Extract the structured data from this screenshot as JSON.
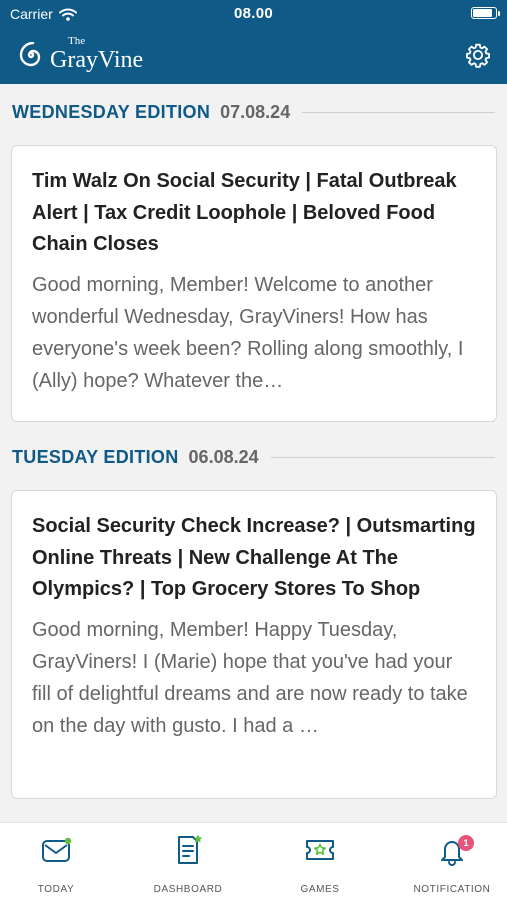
{
  "status_bar": {
    "carrier": "Carrier",
    "time": "08.00"
  },
  "header": {
    "brand_small": "The",
    "brand": "GrayVine"
  },
  "sections": [
    {
      "edition": "WEDNESDAY EDITION",
      "date": "07.08.24",
      "title": "Tim Walz On Social Security | Fatal Outbreak Alert | Tax Credit Loophole | Beloved Food Chain Closes",
      "excerpt": "Good morning, Member! Welcome to another wonderful Wednesday, GrayViners! How has everyone's week been? Rolling along smoothly, I (Ally) hope? Whatever the…"
    },
    {
      "edition": "TUESDAY EDITION",
      "date": "06.08.24",
      "title": "Social Security Check Increase? | Outsmarting Online Threats | New Challenge At The Olympics? | Top Grocery Stores To Shop",
      "excerpt": "Good morning, Member! Happy Tuesday, GrayViners! I (Marie) hope that you've had your fill of delightful dreams and are now ready to take on the day with gusto. I had a …"
    }
  ],
  "nav": {
    "today": "TODAY",
    "dashboard": "DASHBOARD",
    "games": "GAMES",
    "notification": "NOTIFICATION",
    "notification_count": "1"
  },
  "colors": {
    "brand_blue": "#0f5a86",
    "accent_green": "#5fbf3a",
    "badge_pink": "#e8557a"
  }
}
